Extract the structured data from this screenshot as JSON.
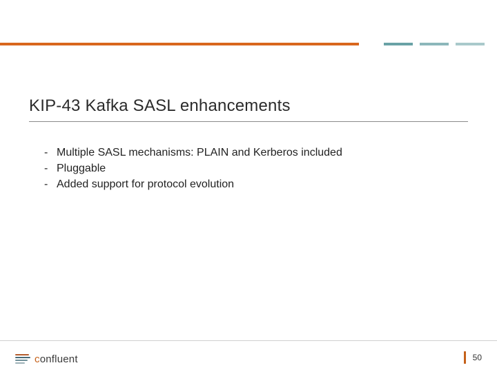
{
  "title": "KIP-43 Kafka SASL enhancements",
  "bullets": [
    "Multiple SASL mechanisms: PLAIN and Kerberos included",
    "Pluggable",
    "Added support for protocol evolution"
  ],
  "footer": {
    "brand_prefix": "c",
    "brand_rest": "onfluent",
    "page_number": "50"
  }
}
